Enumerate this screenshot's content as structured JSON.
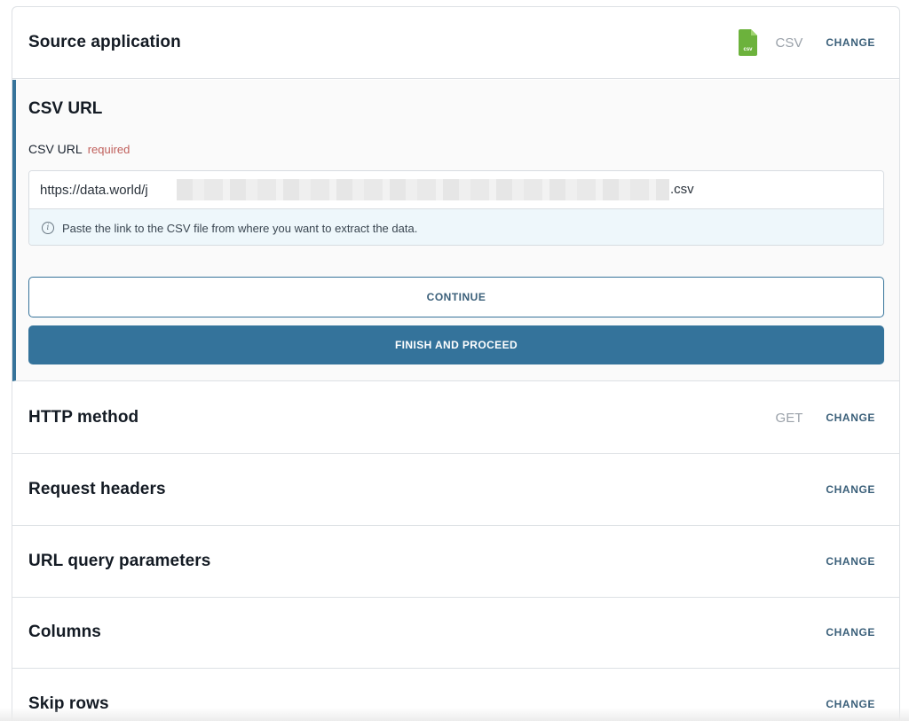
{
  "source_application": {
    "title": "Source application",
    "icon": "csv-file-icon",
    "icon_label": "csv",
    "value": "CSV",
    "change_label": "CHANGE"
  },
  "csv_url_section": {
    "heading": "CSV URL",
    "field_label": "CSV URL",
    "required_label": "required",
    "url_prefix": "https://data.world/j",
    "url_suffix": ".csv",
    "hint": "Paste the link to the CSV file from where you want to extract the data.",
    "continue_label": "CONTINUE",
    "finish_label": "FINISH AND PROCEED"
  },
  "sections": [
    {
      "title": "HTTP method",
      "value": "GET",
      "change_label": "CHANGE"
    },
    {
      "title": "Request headers",
      "value": "",
      "change_label": "CHANGE"
    },
    {
      "title": "URL query parameters",
      "value": "",
      "change_label": "CHANGE"
    },
    {
      "title": "Columns",
      "value": "",
      "change_label": "CHANGE"
    },
    {
      "title": "Skip rows",
      "value": "",
      "change_label": "CHANGE"
    }
  ],
  "colors": {
    "accent": "#34739b",
    "csv_icon_green": "#6cb23c",
    "required_red": "#c0605c",
    "hint_bg": "#eef7fb"
  }
}
